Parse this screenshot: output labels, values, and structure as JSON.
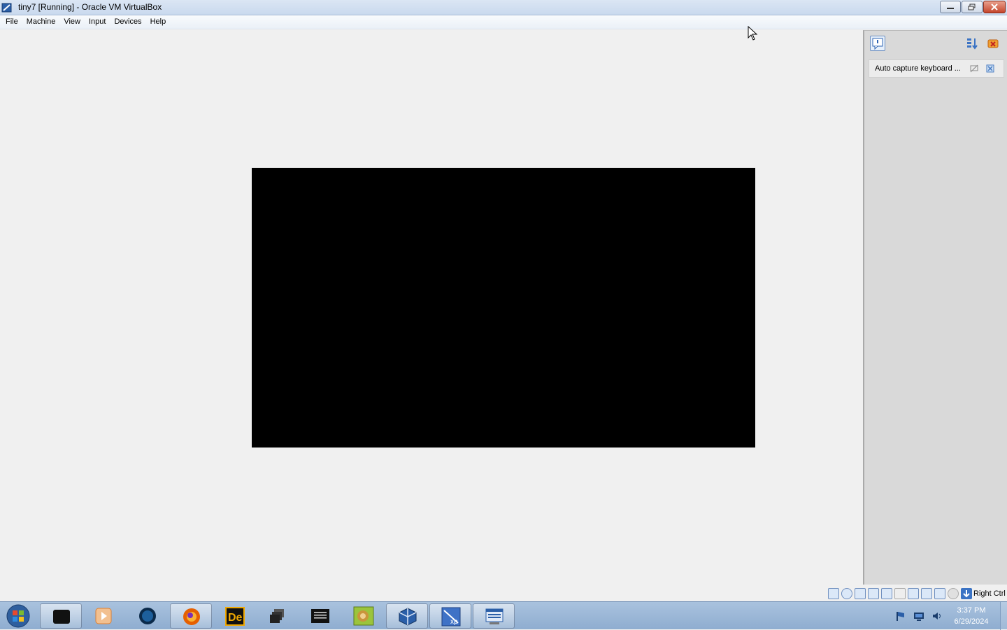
{
  "window": {
    "title": "tiny7 [Running] - Oracle VM VirtualBox"
  },
  "menu": {
    "items": [
      "File",
      "Machine",
      "View",
      "Input",
      "Devices",
      "Help"
    ]
  },
  "notification_panel": {
    "message": "Auto capture keyboard ..."
  },
  "statusbar": {
    "icons": [
      "hard-disk-icon",
      "optical-drive-icon",
      "audio-icon",
      "network-icon",
      "usb-icon",
      "shared-folders-icon",
      "display-icon",
      "video-capture-icon",
      "virtualization-icon",
      "mouse-integration-icon"
    ],
    "host_key": "Right Ctrl"
  },
  "taskbar": {
    "apps": [
      "start-orb-icon",
      "terminal-box-icon",
      "media-player-icon",
      "globe-app-icon",
      "firefox-icon",
      "de-app-icon",
      "stacked-windows-icon",
      "console-icon",
      "lion-box-icon",
      "virtualbox-icon",
      "xp-vm-icon",
      "keyboard-window-icon"
    ],
    "clock_time": "3:37 PM",
    "clock_date": "6/29/2024"
  },
  "colors": {
    "vm_screen": "#000000",
    "taskbar": "#9db8d8",
    "title_bar": "#d3e0f1"
  }
}
